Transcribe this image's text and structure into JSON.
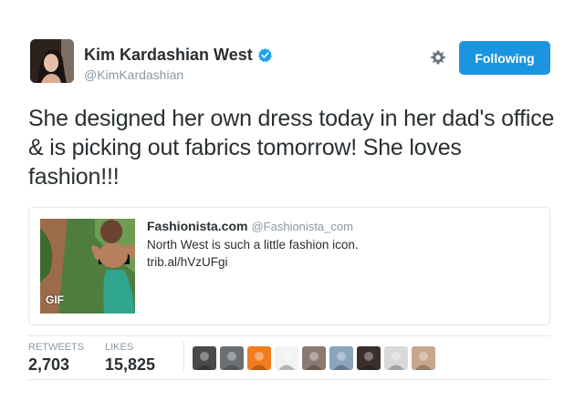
{
  "author": {
    "name": "Kim Kardashian West",
    "handle": "@KimKardashian",
    "verified": true,
    "verified_color": "#1da1f2"
  },
  "actions": {
    "follow_label": "Following",
    "follow_color": "#1b95e0",
    "settings_icon": "gear-icon"
  },
  "tweet": {
    "text": "She designed her own dress today in her dad's office & is picking out fabrics tomorrow! She loves fashion!!!"
  },
  "quoted": {
    "name": "Fashionista.com",
    "handle": "@Fashionista_com",
    "text_line1": "North West is such a little fashion icon.",
    "text_line2": "trib.al/hVzUFgi",
    "media_badge": "GIF"
  },
  "stats": {
    "retweets_label": "RETWEETS",
    "retweets_count": "2,703",
    "likes_label": "LIKES",
    "likes_count": "15,825"
  },
  "likers": [
    {
      "name": "liker-avatar-1",
      "color": "#4a4a4a"
    },
    {
      "name": "liker-avatar-2",
      "color": "#6b6f75"
    },
    {
      "name": "liker-avatar-3",
      "color": "#f07c1e"
    },
    {
      "name": "liker-avatar-4",
      "color": "#f2f2f2"
    },
    {
      "name": "liker-avatar-5",
      "color": "#8a7a72"
    },
    {
      "name": "liker-avatar-6",
      "color": "#8aa4bc"
    },
    {
      "name": "liker-avatar-7",
      "color": "#3a2f2c"
    },
    {
      "name": "liker-avatar-8",
      "color": "#d9d9d9"
    },
    {
      "name": "liker-avatar-9",
      "color": "#c9a58c"
    }
  ]
}
